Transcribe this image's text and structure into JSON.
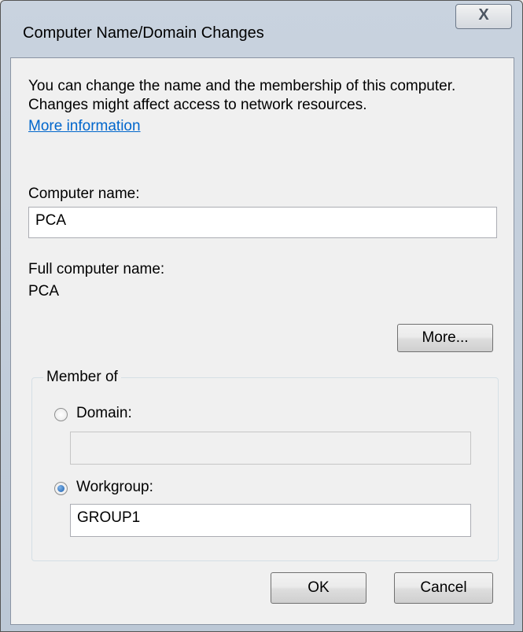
{
  "window": {
    "title": "Computer Name/Domain Changes",
    "close_label": "X"
  },
  "intro": {
    "text": "You can change the name and the membership of this computer. Changes might affect access to network resources.",
    "link": "More information"
  },
  "computer_name": {
    "label": "Computer name:",
    "value": "PCA"
  },
  "full_computer_name": {
    "label": "Full computer name:",
    "value": "PCA"
  },
  "more_button": "More...",
  "member_of": {
    "legend": "Member of",
    "domain_label": "Domain:",
    "domain_value": "",
    "workgroup_label": "Workgroup:",
    "workgroup_value": "GROUP1",
    "selected": "workgroup"
  },
  "buttons": {
    "ok": "OK",
    "cancel": "Cancel"
  }
}
